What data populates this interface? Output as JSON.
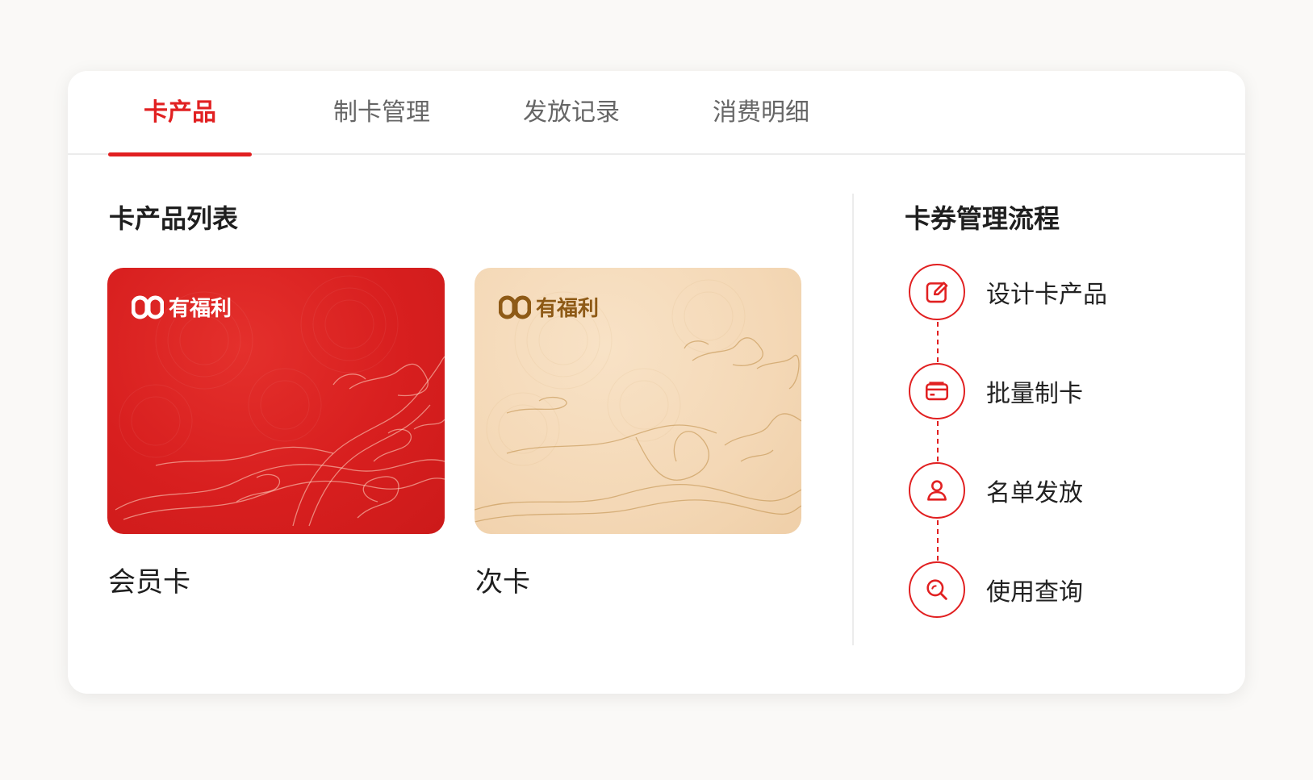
{
  "tabs": [
    {
      "label": "卡产品",
      "active": true
    },
    {
      "label": "制卡管理",
      "active": false
    },
    {
      "label": "发放记录",
      "active": false
    },
    {
      "label": "消费明细",
      "active": false
    }
  ],
  "card_list": {
    "title": "卡产品列表",
    "cards": [
      {
        "name": "会员卡",
        "logo_text": "有福利",
        "style": "red"
      },
      {
        "name": "次卡",
        "logo_text": "有福利",
        "style": "beige"
      }
    ]
  },
  "flow": {
    "title": "卡券管理流程",
    "steps": [
      {
        "label": "设计卡产品",
        "icon": "edit-icon"
      },
      {
        "label": "批量制卡",
        "icon": "card-icon"
      },
      {
        "label": "名单发放",
        "icon": "user-icon"
      },
      {
        "label": "使用查询",
        "icon": "search-icon"
      }
    ]
  },
  "colors": {
    "accent": "#e12021",
    "card_red": "#d81f1f",
    "card_beige": "#f4d8b6",
    "logo_gold": "#8e5a16"
  }
}
